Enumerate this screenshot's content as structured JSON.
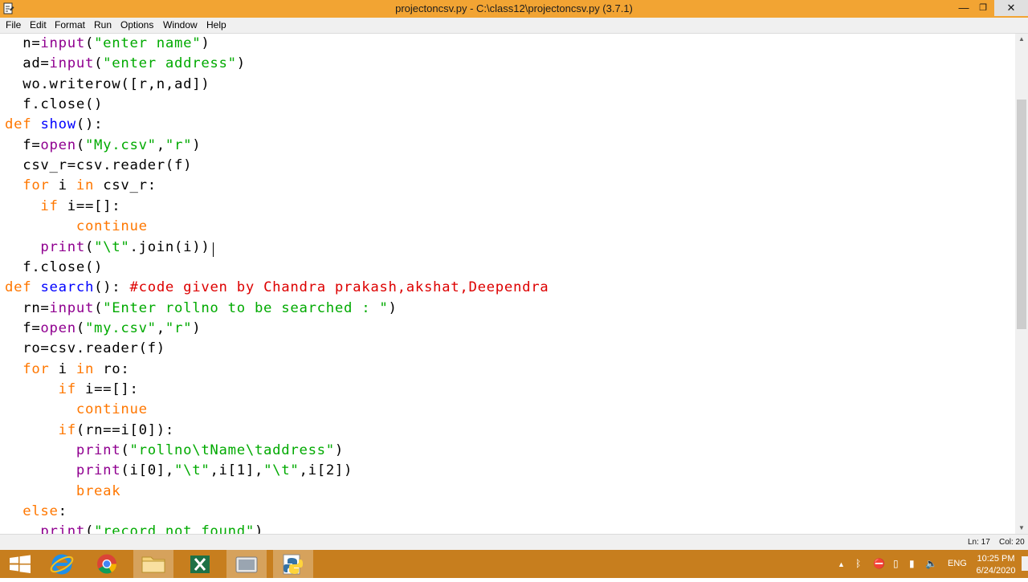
{
  "window": {
    "title": "projectoncsv.py - C:\\class12\\projectoncsv.py (3.7.1)",
    "minimize_glyph": "—",
    "maximize_glyph": "❐",
    "close_glyph": "✕"
  },
  "menu": [
    "File",
    "Edit",
    "Format",
    "Run",
    "Options",
    "Window",
    "Help"
  ],
  "code_lines": [
    [
      {
        "t": "  n=",
        "c": "plain"
      },
      {
        "t": "input",
        "c": "builtin"
      },
      {
        "t": "(",
        "c": "plain"
      },
      {
        "t": "\"enter name\"",
        "c": "string"
      },
      {
        "t": ")",
        "c": "plain"
      }
    ],
    [
      {
        "t": "  ad=",
        "c": "plain"
      },
      {
        "t": "input",
        "c": "builtin"
      },
      {
        "t": "(",
        "c": "plain"
      },
      {
        "t": "\"enter address\"",
        "c": "string"
      },
      {
        "t": ")",
        "c": "plain"
      }
    ],
    [
      {
        "t": "  wo.writerow([r,n,ad])",
        "c": "plain"
      }
    ],
    [
      {
        "t": "  f.close()",
        "c": "plain"
      }
    ],
    [
      {
        "t": "def",
        "c": "keyword"
      },
      {
        "t": " ",
        "c": "plain"
      },
      {
        "t": "show",
        "c": "defname"
      },
      {
        "t": "():",
        "c": "plain"
      }
    ],
    [
      {
        "t": "  f=",
        "c": "plain"
      },
      {
        "t": "open",
        "c": "builtin"
      },
      {
        "t": "(",
        "c": "plain"
      },
      {
        "t": "\"My.csv\"",
        "c": "string"
      },
      {
        "t": ",",
        "c": "plain"
      },
      {
        "t": "\"r\"",
        "c": "string"
      },
      {
        "t": ")",
        "c": "plain"
      }
    ],
    [
      {
        "t": "  csv_r=csv.reader(f)",
        "c": "plain"
      }
    ],
    [
      {
        "t": "  ",
        "c": "plain"
      },
      {
        "t": "for",
        "c": "keyword"
      },
      {
        "t": " i ",
        "c": "plain"
      },
      {
        "t": "in",
        "c": "keyword"
      },
      {
        "t": " csv_r:",
        "c": "plain"
      }
    ],
    [
      {
        "t": "    ",
        "c": "plain"
      },
      {
        "t": "if",
        "c": "keyword"
      },
      {
        "t": " i==[]:",
        "c": "plain"
      }
    ],
    [
      {
        "t": "        ",
        "c": "plain"
      },
      {
        "t": "continue",
        "c": "keyword"
      }
    ],
    [
      {
        "t": "    ",
        "c": "plain"
      },
      {
        "t": "print",
        "c": "builtin"
      },
      {
        "t": "(",
        "c": "plain"
      },
      {
        "t": "\"\\t\"",
        "c": "string"
      },
      {
        "t": ".join(i))",
        "c": "plain"
      }
    ],
    [
      {
        "t": "  f.close()",
        "c": "plain"
      }
    ],
    [
      {
        "t": "def",
        "c": "keyword"
      },
      {
        "t": " ",
        "c": "plain"
      },
      {
        "t": "search",
        "c": "defname"
      },
      {
        "t": "(): ",
        "c": "plain"
      },
      {
        "t": "#code given by Chandra prakash,akshat,Deependra",
        "c": "comment"
      }
    ],
    [
      {
        "t": "  rn=",
        "c": "plain"
      },
      {
        "t": "input",
        "c": "builtin"
      },
      {
        "t": "(",
        "c": "plain"
      },
      {
        "t": "\"Enter rollno to be searched : \"",
        "c": "string"
      },
      {
        "t": ")",
        "c": "plain"
      }
    ],
    [
      {
        "t": "  f=",
        "c": "plain"
      },
      {
        "t": "open",
        "c": "builtin"
      },
      {
        "t": "(",
        "c": "plain"
      },
      {
        "t": "\"my.csv\"",
        "c": "string"
      },
      {
        "t": ",",
        "c": "plain"
      },
      {
        "t": "\"r\"",
        "c": "string"
      },
      {
        "t": ")",
        "c": "plain"
      }
    ],
    [
      {
        "t": "  ro=csv.reader(f)",
        "c": "plain"
      }
    ],
    [
      {
        "t": "  ",
        "c": "plain"
      },
      {
        "t": "for",
        "c": "keyword"
      },
      {
        "t": " i ",
        "c": "plain"
      },
      {
        "t": "in",
        "c": "keyword"
      },
      {
        "t": " ro:",
        "c": "plain"
      }
    ],
    [
      {
        "t": "      ",
        "c": "plain"
      },
      {
        "t": "if",
        "c": "keyword"
      },
      {
        "t": " i==[]:",
        "c": "plain"
      }
    ],
    [
      {
        "t": "        ",
        "c": "plain"
      },
      {
        "t": "continue",
        "c": "keyword"
      }
    ],
    [
      {
        "t": "      ",
        "c": "plain"
      },
      {
        "t": "if",
        "c": "keyword"
      },
      {
        "t": "(rn==i[0]):",
        "c": "plain"
      }
    ],
    [
      {
        "t": "        ",
        "c": "plain"
      },
      {
        "t": "print",
        "c": "builtin"
      },
      {
        "t": "(",
        "c": "plain"
      },
      {
        "t": "\"rollno\\tName\\taddress\"",
        "c": "string"
      },
      {
        "t": ")",
        "c": "plain"
      }
    ],
    [
      {
        "t": "        ",
        "c": "plain"
      },
      {
        "t": "print",
        "c": "builtin"
      },
      {
        "t": "(i[0],",
        "c": "plain"
      },
      {
        "t": "\"\\t\"",
        "c": "string"
      },
      {
        "t": ",i[1],",
        "c": "plain"
      },
      {
        "t": "\"\\t\"",
        "c": "string"
      },
      {
        "t": ",i[2])",
        "c": "plain"
      }
    ],
    [
      {
        "t": "        ",
        "c": "plain"
      },
      {
        "t": "break",
        "c": "keyword"
      }
    ],
    [
      {
        "t": "  ",
        "c": "plain"
      },
      {
        "t": "else",
        "c": "keyword"
      },
      {
        "t": ":",
        "c": "plain"
      }
    ],
    [
      {
        "t": "    ",
        "c": "plain"
      },
      {
        "t": "print",
        "c": "builtin"
      },
      {
        "t": "(",
        "c": "plain"
      },
      {
        "t": "\"record not found\"",
        "c": "string"
      },
      {
        "t": ")",
        "c": "plain"
      }
    ]
  ],
  "status": {
    "line": "Ln: 17",
    "col": "Col: 20"
  },
  "taskbar": {
    "apps": [
      "start",
      "internet-explorer",
      "chrome",
      "file-explorer",
      "excel",
      "media-player",
      "python-idle"
    ],
    "active_app": "python-idle",
    "tray": {
      "language": "ENG",
      "time": "10:25 PM",
      "date": "6/24/2020"
    }
  },
  "colors": {
    "titlebar": "#f2a433",
    "taskbar": "#c77e1e",
    "keyword": "#ff7700",
    "builtin": "#900090",
    "string": "#00aa00",
    "comment": "#dd0000",
    "defname": "#0000ff"
  }
}
